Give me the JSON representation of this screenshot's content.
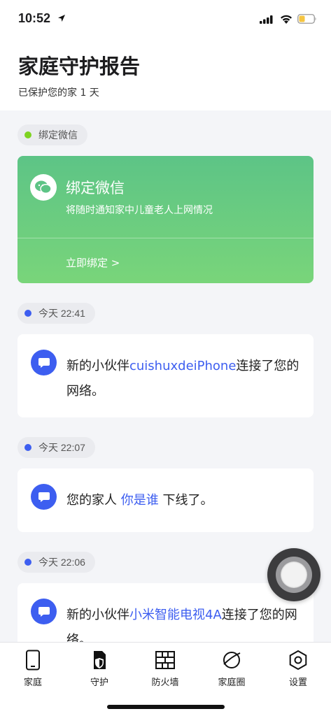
{
  "status_bar": {
    "time": "10:52"
  },
  "header": {
    "title": "家庭守护报告",
    "subtitle": "已保护您的家 1 天"
  },
  "feed": {
    "wechat_pill": {
      "label": "绑定微信",
      "dot_color": "#7ed321"
    },
    "wechat_card": {
      "title": "绑定微信",
      "description": "将随时通知家中儿童老人上网情况",
      "action": "立即绑定 >"
    },
    "events": [
      {
        "time": "今天 22:41",
        "prefix": "新的小伙伴",
        "highlight": "cuishuxdeiPhone",
        "suffix": "连接了您的网络。"
      },
      {
        "time": "今天 22:07",
        "prefix": "您的家人 ",
        "highlight": "你是谁",
        "suffix": " 下线了。"
      },
      {
        "time": "今天 22:06",
        "prefix": "新的小伙伴",
        "highlight": "小米智能电视4A",
        "suffix": "连接了您的网络。"
      }
    ]
  },
  "tabs": [
    {
      "label": "家庭",
      "icon": "phone-icon"
    },
    {
      "label": "守护",
      "icon": "shield-doc-icon"
    },
    {
      "label": "防火墙",
      "icon": "firewall-icon"
    },
    {
      "label": "家庭圈",
      "icon": "planet-icon"
    },
    {
      "label": "设置",
      "icon": "hexagon-gear-icon"
    }
  ],
  "colors": {
    "accent": "#3d5ef0",
    "wechat_green": "#5dc486",
    "background": "#f4f5f8"
  }
}
